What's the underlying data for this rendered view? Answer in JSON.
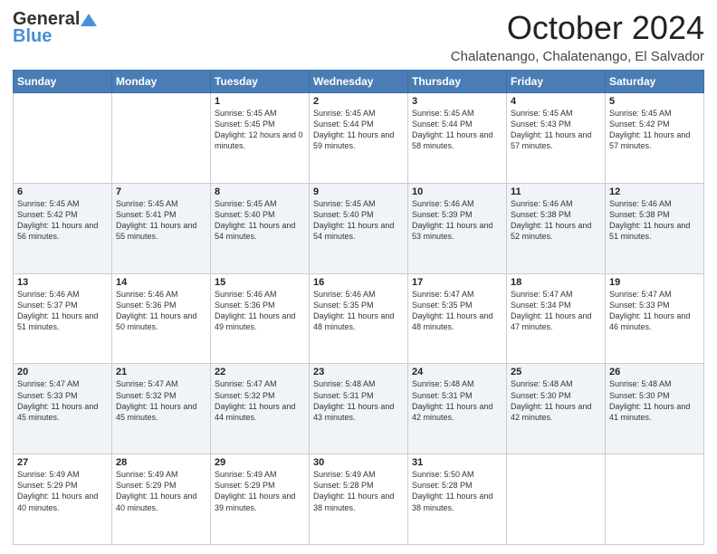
{
  "header": {
    "logo_general": "General",
    "logo_blue": "Blue",
    "month_title": "October 2024",
    "location": "Chalatenango, Chalatenango, El Salvador"
  },
  "days_of_week": [
    "Sunday",
    "Monday",
    "Tuesday",
    "Wednesday",
    "Thursday",
    "Friday",
    "Saturday"
  ],
  "weeks": [
    [
      {
        "day": "",
        "sunrise": "",
        "sunset": "",
        "daylight": ""
      },
      {
        "day": "",
        "sunrise": "",
        "sunset": "",
        "daylight": ""
      },
      {
        "day": "1",
        "sunrise": "Sunrise: 5:45 AM",
        "sunset": "Sunset: 5:45 PM",
        "daylight": "Daylight: 12 hours and 0 minutes."
      },
      {
        "day": "2",
        "sunrise": "Sunrise: 5:45 AM",
        "sunset": "Sunset: 5:44 PM",
        "daylight": "Daylight: 11 hours and 59 minutes."
      },
      {
        "day": "3",
        "sunrise": "Sunrise: 5:45 AM",
        "sunset": "Sunset: 5:44 PM",
        "daylight": "Daylight: 11 hours and 58 minutes."
      },
      {
        "day": "4",
        "sunrise": "Sunrise: 5:45 AM",
        "sunset": "Sunset: 5:43 PM",
        "daylight": "Daylight: 11 hours and 57 minutes."
      },
      {
        "day": "5",
        "sunrise": "Sunrise: 5:45 AM",
        "sunset": "Sunset: 5:42 PM",
        "daylight": "Daylight: 11 hours and 57 minutes."
      }
    ],
    [
      {
        "day": "6",
        "sunrise": "Sunrise: 5:45 AM",
        "sunset": "Sunset: 5:42 PM",
        "daylight": "Daylight: 11 hours and 56 minutes."
      },
      {
        "day": "7",
        "sunrise": "Sunrise: 5:45 AM",
        "sunset": "Sunset: 5:41 PM",
        "daylight": "Daylight: 11 hours and 55 minutes."
      },
      {
        "day": "8",
        "sunrise": "Sunrise: 5:45 AM",
        "sunset": "Sunset: 5:40 PM",
        "daylight": "Daylight: 11 hours and 54 minutes."
      },
      {
        "day": "9",
        "sunrise": "Sunrise: 5:45 AM",
        "sunset": "Sunset: 5:40 PM",
        "daylight": "Daylight: 11 hours and 54 minutes."
      },
      {
        "day": "10",
        "sunrise": "Sunrise: 5:46 AM",
        "sunset": "Sunset: 5:39 PM",
        "daylight": "Daylight: 11 hours and 53 minutes."
      },
      {
        "day": "11",
        "sunrise": "Sunrise: 5:46 AM",
        "sunset": "Sunset: 5:38 PM",
        "daylight": "Daylight: 11 hours and 52 minutes."
      },
      {
        "day": "12",
        "sunrise": "Sunrise: 5:46 AM",
        "sunset": "Sunset: 5:38 PM",
        "daylight": "Daylight: 11 hours and 51 minutes."
      }
    ],
    [
      {
        "day": "13",
        "sunrise": "Sunrise: 5:46 AM",
        "sunset": "Sunset: 5:37 PM",
        "daylight": "Daylight: 11 hours and 51 minutes."
      },
      {
        "day": "14",
        "sunrise": "Sunrise: 5:46 AM",
        "sunset": "Sunset: 5:36 PM",
        "daylight": "Daylight: 11 hours and 50 minutes."
      },
      {
        "day": "15",
        "sunrise": "Sunrise: 5:46 AM",
        "sunset": "Sunset: 5:36 PM",
        "daylight": "Daylight: 11 hours and 49 minutes."
      },
      {
        "day": "16",
        "sunrise": "Sunrise: 5:46 AM",
        "sunset": "Sunset: 5:35 PM",
        "daylight": "Daylight: 11 hours and 48 minutes."
      },
      {
        "day": "17",
        "sunrise": "Sunrise: 5:47 AM",
        "sunset": "Sunset: 5:35 PM",
        "daylight": "Daylight: 11 hours and 48 minutes."
      },
      {
        "day": "18",
        "sunrise": "Sunrise: 5:47 AM",
        "sunset": "Sunset: 5:34 PM",
        "daylight": "Daylight: 11 hours and 47 minutes."
      },
      {
        "day": "19",
        "sunrise": "Sunrise: 5:47 AM",
        "sunset": "Sunset: 5:33 PM",
        "daylight": "Daylight: 11 hours and 46 minutes."
      }
    ],
    [
      {
        "day": "20",
        "sunrise": "Sunrise: 5:47 AM",
        "sunset": "Sunset: 5:33 PM",
        "daylight": "Daylight: 11 hours and 45 minutes."
      },
      {
        "day": "21",
        "sunrise": "Sunrise: 5:47 AM",
        "sunset": "Sunset: 5:32 PM",
        "daylight": "Daylight: 11 hours and 45 minutes."
      },
      {
        "day": "22",
        "sunrise": "Sunrise: 5:47 AM",
        "sunset": "Sunset: 5:32 PM",
        "daylight": "Daylight: 11 hours and 44 minutes."
      },
      {
        "day": "23",
        "sunrise": "Sunrise: 5:48 AM",
        "sunset": "Sunset: 5:31 PM",
        "daylight": "Daylight: 11 hours and 43 minutes."
      },
      {
        "day": "24",
        "sunrise": "Sunrise: 5:48 AM",
        "sunset": "Sunset: 5:31 PM",
        "daylight": "Daylight: 11 hours and 42 minutes."
      },
      {
        "day": "25",
        "sunrise": "Sunrise: 5:48 AM",
        "sunset": "Sunset: 5:30 PM",
        "daylight": "Daylight: 11 hours and 42 minutes."
      },
      {
        "day": "26",
        "sunrise": "Sunrise: 5:48 AM",
        "sunset": "Sunset: 5:30 PM",
        "daylight": "Daylight: 11 hours and 41 minutes."
      }
    ],
    [
      {
        "day": "27",
        "sunrise": "Sunrise: 5:49 AM",
        "sunset": "Sunset: 5:29 PM",
        "daylight": "Daylight: 11 hours and 40 minutes."
      },
      {
        "day": "28",
        "sunrise": "Sunrise: 5:49 AM",
        "sunset": "Sunset: 5:29 PM",
        "daylight": "Daylight: 11 hours and 40 minutes."
      },
      {
        "day": "29",
        "sunrise": "Sunrise: 5:49 AM",
        "sunset": "Sunset: 5:29 PM",
        "daylight": "Daylight: 11 hours and 39 minutes."
      },
      {
        "day": "30",
        "sunrise": "Sunrise: 5:49 AM",
        "sunset": "Sunset: 5:28 PM",
        "daylight": "Daylight: 11 hours and 38 minutes."
      },
      {
        "day": "31",
        "sunrise": "Sunrise: 5:50 AM",
        "sunset": "Sunset: 5:28 PM",
        "daylight": "Daylight: 11 hours and 38 minutes."
      },
      {
        "day": "",
        "sunrise": "",
        "sunset": "",
        "daylight": ""
      },
      {
        "day": "",
        "sunrise": "",
        "sunset": "",
        "daylight": ""
      }
    ]
  ]
}
